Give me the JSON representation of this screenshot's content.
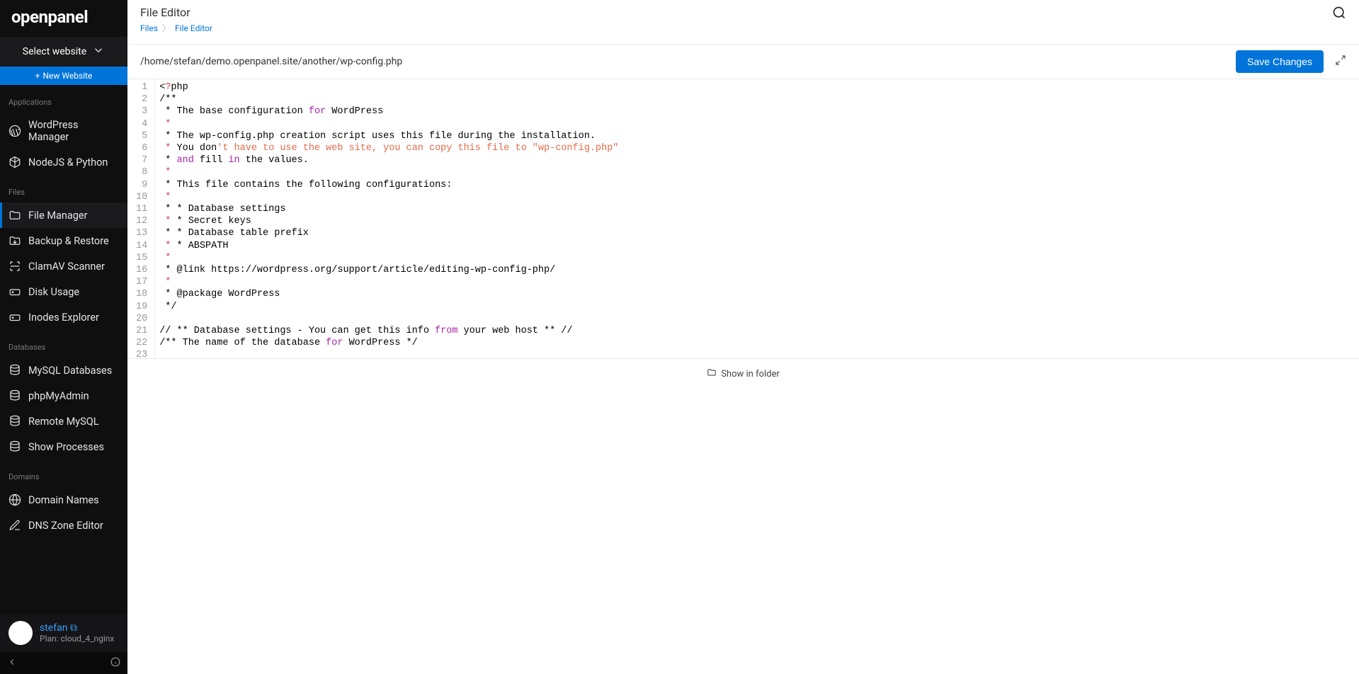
{
  "app": {
    "name": "openpanel"
  },
  "site_selector": {
    "label": "Select website"
  },
  "new_website": {
    "label": "New Website"
  },
  "nav": {
    "sections": [
      {
        "title": "Applications",
        "items": [
          {
            "id": "wp-manager",
            "label": "WordPress Manager",
            "icon": "wordpress"
          },
          {
            "id": "node-python",
            "label": "NodeJS & Python",
            "icon": "cube"
          }
        ]
      },
      {
        "title": "Files",
        "items": [
          {
            "id": "file-manager",
            "label": "File Manager",
            "icon": "folder",
            "active": true
          },
          {
            "id": "backup-restore",
            "label": "Backup & Restore",
            "icon": "folder-in"
          },
          {
            "id": "clamav",
            "label": "ClamAV Scanner",
            "icon": "scan"
          },
          {
            "id": "disk-usage",
            "label": "Disk Usage",
            "icon": "drive"
          },
          {
            "id": "inodes",
            "label": "Inodes Explorer",
            "icon": "drive"
          }
        ]
      },
      {
        "title": "Databases",
        "items": [
          {
            "id": "mysql-db",
            "label": "MySQL Databases",
            "icon": "database"
          },
          {
            "id": "phpmyadmin",
            "label": "phpMyAdmin",
            "icon": "database"
          },
          {
            "id": "remote-mysql",
            "label": "Remote MySQL",
            "icon": "database"
          },
          {
            "id": "processes",
            "label": "Show Processes",
            "icon": "database"
          }
        ]
      },
      {
        "title": "Domains",
        "items": [
          {
            "id": "domains",
            "label": "Domain Names",
            "icon": "globe"
          },
          {
            "id": "dns-zone",
            "label": "DNS Zone Editor",
            "icon": "edit"
          }
        ]
      }
    ]
  },
  "user": {
    "name": "stefan",
    "plan": "Plan: cloud_4_nginx"
  },
  "header": {
    "title": "File Editor",
    "breadcrumb": {
      "root": "Files",
      "current": "File Editor"
    }
  },
  "editor": {
    "path": "/home/stefan/demo.openpanel.site/another/wp-config.php",
    "save_label": "Save Changes",
    "show_folder_label": "Show in folder",
    "lines": [
      [
        {
          "t": "<",
          "c": ""
        },
        {
          "t": "?",
          "c": "red"
        },
        {
          "t": "php",
          "c": ""
        }
      ],
      [
        {
          "t": "/**",
          "c": ""
        }
      ],
      [
        {
          "t": " * ",
          "c": ""
        },
        {
          "t": "The base configuration ",
          "c": ""
        },
        {
          "t": "for",
          "c": "kw"
        },
        {
          "t": " WordPress",
          "c": ""
        }
      ],
      [
        {
          "t": " *",
          "c": "red"
        }
      ],
      [
        {
          "t": " * ",
          "c": ""
        },
        {
          "t": "The wp-config.php creation script uses this file during the installation.",
          "c": ""
        }
      ],
      [
        {
          "t": " *",
          "c": "red"
        },
        {
          "t": " You don",
          "c": ""
        },
        {
          "t": "'t have to use the web site, you can copy this file to \"wp-config.php\"",
          "c": "str"
        }
      ],
      [
        {
          "t": " * ",
          "c": ""
        },
        {
          "t": "and",
          "c": "kw"
        },
        {
          "t": " fill ",
          "c": ""
        },
        {
          "t": "in",
          "c": "kw"
        },
        {
          "t": " the values.",
          "c": ""
        }
      ],
      [
        {
          "t": " *",
          "c": "red"
        }
      ],
      [
        {
          "t": " * ",
          "c": ""
        },
        {
          "t": "This file contains the following configurations:",
          "c": ""
        }
      ],
      [
        {
          "t": " *",
          "c": "red"
        }
      ],
      [
        {
          "t": " * * Database settings",
          "c": ""
        }
      ],
      [
        {
          "t": " *",
          "c": "red"
        },
        {
          "t": " * Secret keys",
          "c": ""
        }
      ],
      [
        {
          "t": " * * Database table prefix",
          "c": ""
        }
      ],
      [
        {
          "t": " *",
          "c": "red"
        },
        {
          "t": " * ABSPATH",
          "c": ""
        }
      ],
      [
        {
          "t": " *",
          "c": "red"
        }
      ],
      [
        {
          "t": " * ",
          "c": ""
        },
        {
          "t": "@link https://wordpress.org/support/article/editing-wp-config-php/",
          "c": ""
        }
      ],
      [
        {
          "t": " *",
          "c": "red"
        }
      ],
      [
        {
          "t": " * ",
          "c": ""
        },
        {
          "t": "@package WordPress",
          "c": ""
        }
      ],
      [
        {
          "t": " */",
          "c": ""
        }
      ],
      [
        {
          "t": "",
          "c": ""
        }
      ],
      [
        {
          "t": "// ** Database settings - You can get this info ",
          "c": ""
        },
        {
          "t": "from",
          "c": "kw"
        },
        {
          "t": " your web host ** //",
          "c": ""
        }
      ],
      [
        {
          "t": "/** The name of the database ",
          "c": ""
        },
        {
          "t": "for",
          "c": "kw"
        },
        {
          "t": " WordPress */",
          "c": ""
        }
      ],
      [
        {
          "t": "",
          "c": ""
        }
      ]
    ]
  }
}
